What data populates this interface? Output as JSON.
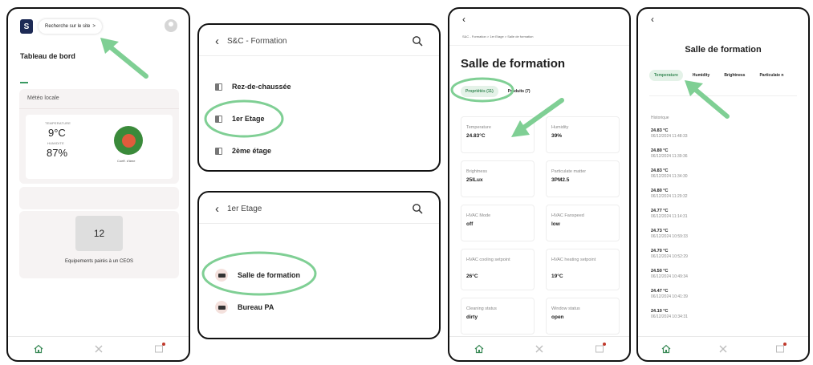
{
  "colors": {
    "accent": "#3a8a57",
    "highlight": "#7fcf94",
    "brand": "#1d2a55"
  },
  "panel1": {
    "logo_letter": "S",
    "search_label": "Recherche sur le site",
    "search_chevron": ">",
    "dashboard_title": "Tableau de bord",
    "meteo_title": "Météo locale",
    "temperature_label": "TEMPERATURE",
    "temperature_value": "9°C",
    "humidity_label": "HUMIDITE",
    "humidity_value": "87%",
    "air_quality_label": "Coeff. d'âme",
    "equipment_count": "12",
    "equipment_label": "Equipements pairés à un CEOS"
  },
  "panel2": {
    "title": "S&C - Formation",
    "items": [
      {
        "label": "Rez-de-chaussée"
      },
      {
        "label": "1er Etage"
      },
      {
        "label": "2ème étage"
      }
    ]
  },
  "panel3": {
    "title": "1er Etage",
    "items": [
      {
        "label": "Salle de formation"
      },
      {
        "label": "Bureau PA"
      }
    ]
  },
  "panel4": {
    "breadcrumb": "S&C - Formation > 1er Etage > Salle de formation",
    "title": "Salle de formation",
    "tab_properties": "Propriétés (11)",
    "tab_products": "Produits (7)",
    "properties": [
      {
        "label": "Temperature",
        "value": "24.83°C"
      },
      {
        "label": "Humidity",
        "value": "39%"
      },
      {
        "label": "Brightness",
        "value": "25lLux"
      },
      {
        "label": "Particulate matter",
        "value": "3PM2.5"
      },
      {
        "label": "HVAC Mode",
        "value": "off"
      },
      {
        "label": "HVAC Fanspeed",
        "value": "low"
      },
      {
        "label": "HVAC cooling setpoint",
        "value": "26°C"
      },
      {
        "label": "HVAC heating setpoint",
        "value": "19°C"
      },
      {
        "label": "Cleaning status",
        "value": "dirty"
      },
      {
        "label": "Window status",
        "value": "open"
      }
    ]
  },
  "panel5": {
    "title": "Salle de formation",
    "tabs": [
      "Temperature",
      "Humidity",
      "Brightness",
      "Particulate n"
    ],
    "history_label": "Historique",
    "history": [
      {
        "value": "24.83 °C",
        "date": "06/12/2024 11:48:33"
      },
      {
        "value": "24.80 °C",
        "date": "06/12/2024 11:39:36"
      },
      {
        "value": "24.83 °C",
        "date": "06/12/2024 11:34:30"
      },
      {
        "value": "24.80 °C",
        "date": "06/12/2024 11:29:32"
      },
      {
        "value": "24.77 °C",
        "date": "06/12/2024 11:14:31"
      },
      {
        "value": "24.73 °C",
        "date": "06/12/2024 10:59:33"
      },
      {
        "value": "24.70 °C",
        "date": "06/12/2024 10:52:29"
      },
      {
        "value": "24.50 °C",
        "date": "06/12/2024 10:49:34"
      },
      {
        "value": "24.47 °C",
        "date": "06/12/2024 10:41:39"
      },
      {
        "value": "24.10 °C",
        "date": "06/12/2024 10:34:31"
      }
    ]
  }
}
